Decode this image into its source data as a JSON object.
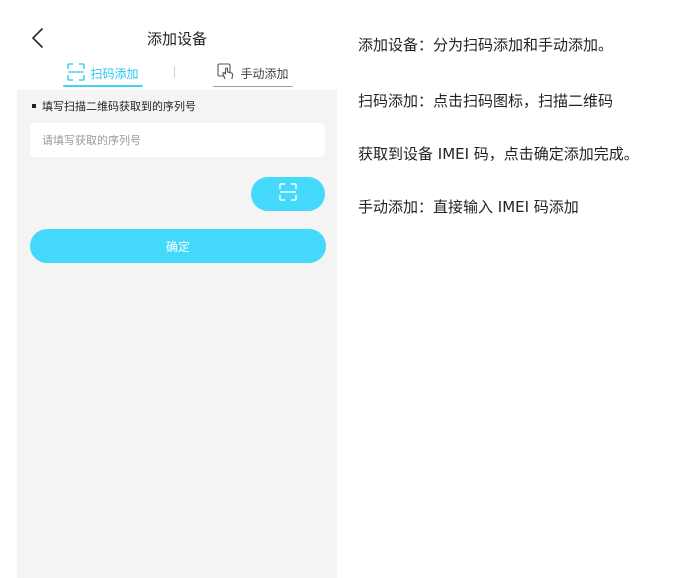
{
  "header": {
    "title": "添加设备",
    "back_icon": "chevron-left-icon"
  },
  "tabs": [
    {
      "label": "扫码添加",
      "icon": "scan-frame-icon",
      "active": true
    },
    {
      "label": "手动添加",
      "icon": "hand-tap-icon",
      "active": false
    }
  ],
  "form": {
    "hint": "填写扫描二维码获取到的序列号",
    "serial_placeholder": "请填写获取的序列号",
    "serial_value": "",
    "scan_button_icon": "scan-frame-icon",
    "confirm_label": "确定"
  },
  "notes": [
    "添加设备：分为扫码添加和手动添加。",
    "扫码添加：点击扫码图标，扫描二维码",
    "获取到设备 IMEI 码，点击确定添加完成。",
    "手动添加：直接输入 IMEI 码添加"
  ],
  "colors": {
    "accent": "#44d8fb",
    "accent_text": "#26c6f2",
    "screen_bg": "#f4f4f4"
  }
}
